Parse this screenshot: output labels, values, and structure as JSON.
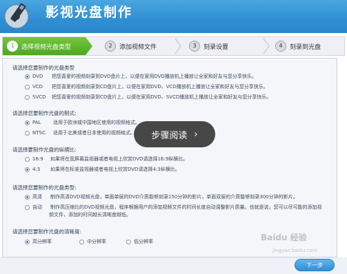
{
  "app": {
    "title": "影视光盘制作"
  },
  "steps": [
    {
      "num": "1",
      "label": "选择视频光盘类型",
      "active": true
    },
    {
      "num": "2",
      "label": "添加视频文件",
      "active": false
    },
    {
      "num": "3",
      "label": "刻录设置",
      "active": false
    },
    {
      "num": "4",
      "label": "刻录到光盘",
      "active": false
    }
  ],
  "sections": {
    "disc_type": {
      "title": "请选择您要制作的光盘类型",
      "options": [
        {
          "name": "DVD",
          "desc": "把您喜爱的视频刻录到DVD盘片上，以便在家用DVD播放机上播放让全家和好友与您分享快乐。",
          "selected": true
        },
        {
          "name": "VCD",
          "desc": "把您喜爱的视频刻录到CD盘片上，以便在家用DVD、VCD播放机上播放让全家和好友与您分享快乐。",
          "selected": false
        },
        {
          "name": "SVCD",
          "desc": "把您喜爱的视频刻录到CD盘片上，以便在家用DVD、SVCD播放机上播放让全家和好友与您分享快乐。",
          "selected": false
        }
      ]
    },
    "tv_system": {
      "title": "请选择您要制作光盘的制式:",
      "options": [
        {
          "name": "PAL",
          "desc": "适用于欧洲或中国地区使用的视频格式。",
          "selected": true
        },
        {
          "name": "NTSC",
          "desc": "适用于北美或者日本使用的视频格式。",
          "selected": false
        }
      ]
    },
    "aspect": {
      "title": "请选择要制作光盘的纵横比:",
      "options": [
        {
          "name": "16:9",
          "desc": "如果将在宽屏幕监视器或者电视上欣赏DVD请选择16:9纵横比。",
          "selected": false
        },
        {
          "name": "4:3",
          "desc": "如果将在标准监视器或者电视上欣赏DVD请选择4:3纵横比。",
          "selected": true
        }
      ]
    },
    "disc_kind": {
      "title": "请选择您要制作的光盘类型:",
      "options": [
        {
          "name": "高清",
          "desc": "制作高清DVD视频光盘，单面单层的DVD介质能够刻录150分钟的影片，单面双层的介质能够刻录300分钟的影片。",
          "selected": true
        },
        {
          "name": "自动",
          "desc": "制作高压缩比的DVD视频光盘，程序根据用户的添加视频文件的时间长度自动调整影片质量。也就是说，您可以尽可能的添加视",
          "desc2": "频文件，添加的时间越长清晰度越低。",
          "selected": false
        }
      ]
    },
    "quality": {
      "title": "请选择您要制作光盘的清晰度:",
      "options": [
        {
          "name": "高分辨率",
          "selected": true
        },
        {
          "name": "中分辨率",
          "selected": false
        },
        {
          "name": "低分辨率",
          "selected": false
        }
      ]
    }
  },
  "overlay": {
    "label": "步骤阅读"
  },
  "next_button": {
    "label": "下一步"
  },
  "watermark": {
    "text": "Baidu 经验",
    "sub": "jingyan.baidu.com"
  }
}
